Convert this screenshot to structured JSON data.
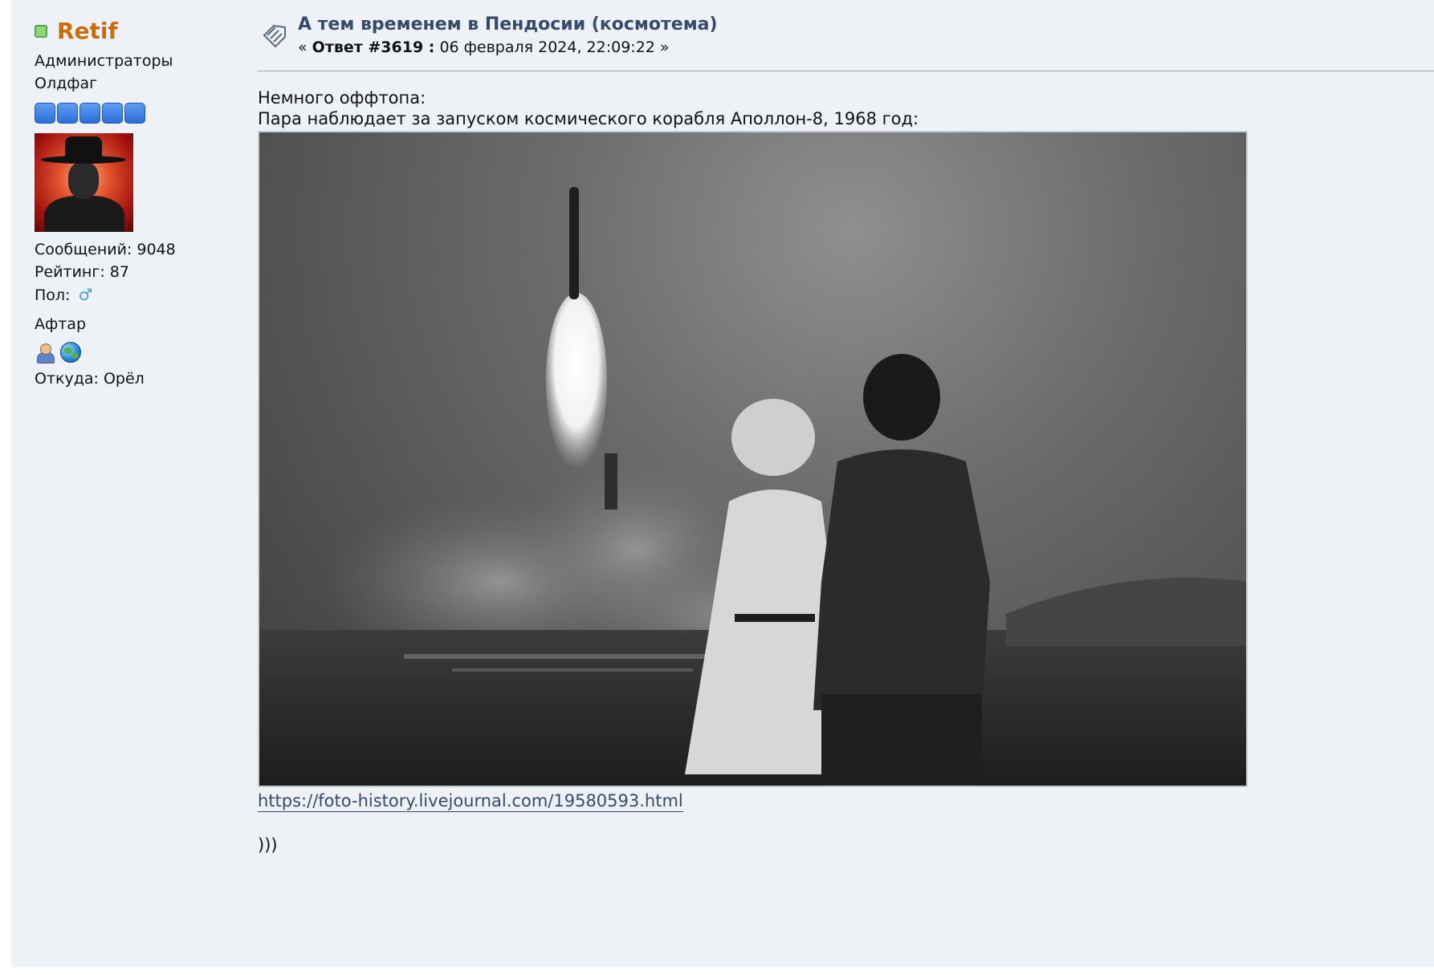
{
  "poster": {
    "name": "Retif",
    "group": "Администраторы",
    "post_group": "Олдфаг",
    "stars_count": 5,
    "posts": "Сообщений: 9048",
    "rating": "Рейтинг: 87",
    "gender_label": "Пол:",
    "gender_symbol": "♂",
    "custom_title": "Афтар",
    "location": "Откуда: Орёл",
    "online_color": "#8fd67a",
    "name_color": "#c66d0e"
  },
  "post": {
    "title": "А тем временем в Пендосии (космотема)",
    "meta_prefix": "«",
    "meta_reply": "Ответ #3619 :",
    "meta_date": "06 февраля 2024, 22:09:22",
    "meta_suffix": "»",
    "line1": "Немного оффтопа:",
    "line2": "Пара наблюдает за запуском космического корабля Аполлон-8, 1968 год:",
    "link": "https://foto-history.livejournal.com/19580593.html",
    "closing": ")))",
    "title_color": "#364a6b"
  },
  "icons": {
    "post_icon": "message-icon",
    "profile": "profile-icon",
    "website": "globe-icon"
  }
}
